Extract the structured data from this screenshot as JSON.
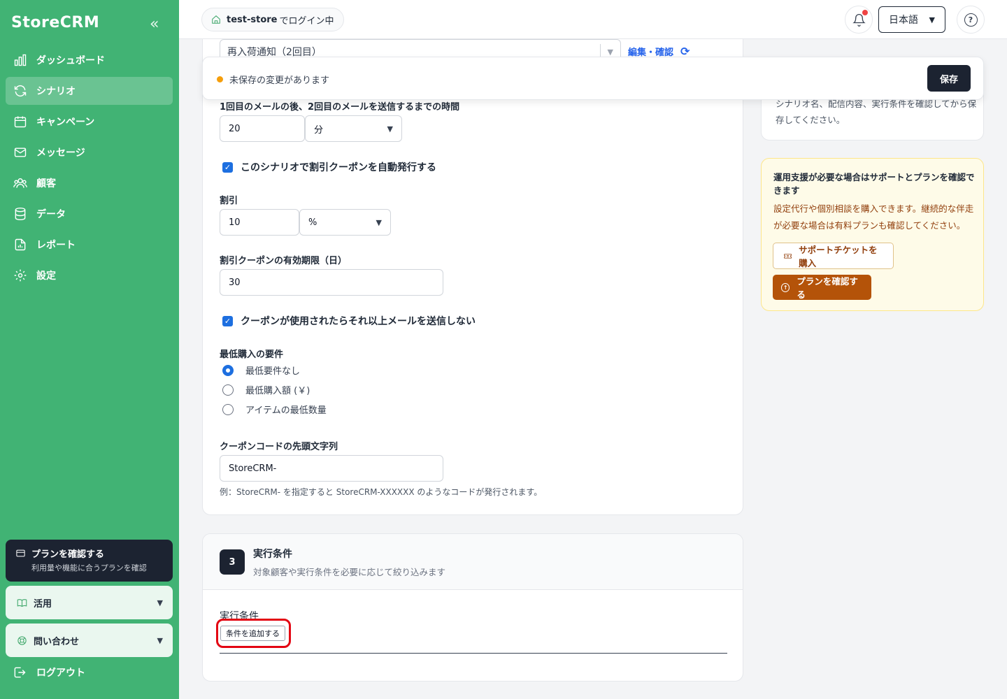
{
  "sidebar": {
    "brand": "StoreCRM",
    "collapse_icon": "«",
    "items": [
      {
        "label": "ダッシュボード",
        "icon": "bar-chart-icon",
        "active": false
      },
      {
        "label": "シナリオ",
        "icon": "refresh-icon",
        "active": true
      },
      {
        "label": "キャンペーン",
        "icon": "calendar-icon",
        "active": false
      },
      {
        "label": "メッセージ",
        "icon": "mail-icon",
        "active": false
      },
      {
        "label": "顧客",
        "icon": "users-icon",
        "active": false
      },
      {
        "label": "データ",
        "icon": "database-icon",
        "active": false
      },
      {
        "label": "レポート",
        "icon": "file-chart-icon",
        "active": false
      },
      {
        "label": "設定",
        "icon": "gear-icon",
        "active": false
      }
    ],
    "plan": {
      "title": "プランを確認する",
      "subtitle": "利用量や機能に合うプランを確認"
    },
    "accordions": [
      {
        "label": "活用",
        "icon": "book-icon"
      },
      {
        "label": "問い合わせ",
        "icon": "support-icon"
      }
    ],
    "logout": "ログアウト"
  },
  "topbar": {
    "store_name": "test-store",
    "store_suffix": "でログイン中",
    "language": "日本語"
  },
  "unsaved": {
    "message": "未保存の変更があります",
    "save_label": "保存"
  },
  "form": {
    "template_select": "再入荷通知（2回目）",
    "edit_link": "編集・確認",
    "delay_label": "1回目のメールの後、2回目のメールを送信するまでの時間",
    "delay_value": "20",
    "delay_unit": "分",
    "auto_coupon_label": "このシナリオで割引クーポンを自動発行する",
    "auto_coupon_checked": true,
    "discount_label": "割引",
    "discount_value": "10",
    "discount_unit": "%",
    "expiry_label": "割引クーポンの有効期限（日）",
    "expiry_value": "30",
    "stop_label": "クーポンが使用されたらそれ以上メールを送信しない",
    "stop_checked": true,
    "min_req_label": "最低購入の要件",
    "min_options": [
      {
        "label": "最低要件なし",
        "selected": true
      },
      {
        "label": "最低購入額 (￥)",
        "selected": false
      },
      {
        "label": "アイテムの最低数量",
        "selected": false
      }
    ],
    "prefix_label": "クーポンコードの先頭文字列",
    "prefix_value": "StoreCRM-",
    "prefix_hint": "例：StoreCRM- を指定すると StoreCRM-XXXXXX のようなコードが発行されます。"
  },
  "right": {
    "save_note": "シナリオ名、配信内容、実行条件を確認してから保存してください。",
    "support_title": "運用支援が必要な場合はサポートとプランを確認できます",
    "support_text": "設定代行や個別相談を購入できます。継続的な伴走が必要な場合は有料プランも確認してください。",
    "ticket_button": "サポートチケットを購入",
    "plan_button": "プランを確認する"
  },
  "section3": {
    "number": "3",
    "title": "実行条件",
    "subtitle": "対象顧客や実行条件を必要に応じて絞り込みます",
    "conditions_label": "実行条件",
    "add_condition": "条件を追加する"
  },
  "colors": {
    "sidebar": "#41b374",
    "accent_blue": "#1d6fe0",
    "dark": "#1c2331",
    "warning": "#f59e0b",
    "highlight": "#e30613"
  }
}
